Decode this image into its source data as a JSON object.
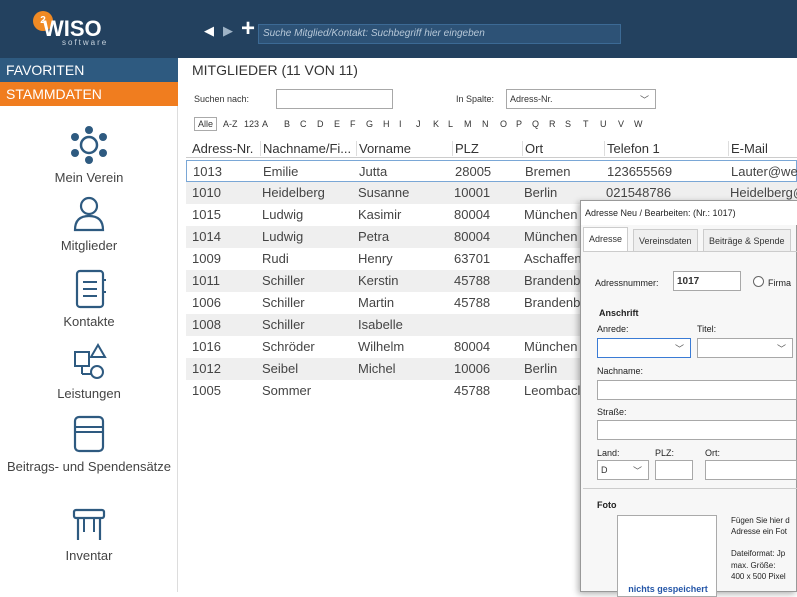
{
  "app": {
    "logo_badge": "2",
    "logo_text": "WISO",
    "logo_sub": "software"
  },
  "toolbar": {
    "back_icon": "chevron-left-icon",
    "forward_icon": "chevron-right-icon",
    "add_icon": "plus-icon",
    "search_placeholder": "Suche Mitglied/Kontakt: Suchbegriff hier eingeben"
  },
  "sidebar": {
    "favoriten": "FAVORITEN",
    "stammdaten": "STAMMDATEN",
    "items": [
      {
        "label": "Mein Verein",
        "icon": "network-icon"
      },
      {
        "label": "Mitglieder",
        "icon": "person-icon"
      },
      {
        "label": "Kontakte",
        "icon": "contact-book-icon"
      },
      {
        "label": "Leistungen",
        "icon": "shapes-icon"
      },
      {
        "label": "Beitrags- und Spendensätze",
        "icon": "wallet-icon"
      },
      {
        "label": "Inventar",
        "icon": "table-icon"
      }
    ]
  },
  "main": {
    "title": "MITGLIEDER (11 VON 11)",
    "search_label": "Suchen nach:",
    "search_value": "",
    "column_label": "In Spalte:",
    "column_value": "Adress-Nr.",
    "alpha_all": "Alle",
    "alpha": [
      "A-Z",
      "123",
      "A",
      "B",
      "C",
      "D",
      "E",
      "F",
      "G",
      "H",
      "I",
      "J",
      "K",
      "L",
      "M",
      "N",
      "O",
      "P",
      "Q",
      "R",
      "S",
      "T",
      "U",
      "V",
      "W"
    ]
  },
  "table": {
    "columns": [
      "Adress-Nr.",
      "Nachname/Fi...",
      "Vorname",
      "PLZ",
      "Ort",
      "Telefon 1",
      "E-Mail"
    ],
    "rows": [
      [
        "1013",
        "Emilie",
        "Jutta",
        "28005",
        "Bremen",
        "123655569",
        "Lauter@web"
      ],
      [
        "1010",
        "Heidelberg",
        "Susanne",
        "10001",
        "Berlin",
        "021548786",
        "Heidelberg@"
      ],
      [
        "1015",
        "Ludwig",
        "Kasimir",
        "80004",
        "München",
        "",
        ""
      ],
      [
        "1014",
        "Ludwig",
        "Petra",
        "80004",
        "München",
        "",
        ""
      ],
      [
        "1009",
        "Rudi",
        "Henry",
        "63701",
        "Aschaffen",
        "",
        ""
      ],
      [
        "1011",
        "Schiller",
        "Kerstin",
        "45788",
        "Brandenb",
        "",
        ""
      ],
      [
        "1006",
        "Schiller",
        "Martin",
        "45788",
        "Brandenb",
        "",
        ""
      ],
      [
        "1008",
        "Schiller",
        "Isabelle",
        "",
        "",
        "",
        ""
      ],
      [
        "1016",
        "Schröder",
        "Wilhelm",
        "80004",
        "München",
        "",
        ""
      ],
      [
        "1012",
        "Seibel",
        "Michel",
        "10006",
        "Berlin",
        "",
        ""
      ],
      [
        "1005",
        "Sommer",
        "",
        "45788",
        "Leombacl",
        "",
        ""
      ]
    ]
  },
  "dialog": {
    "title": "Adresse Neu / Bearbeiten: (Nr.: 1017)",
    "tabs": [
      "Adresse",
      "Vereinsdaten",
      "Beiträge & Spende"
    ],
    "adressnummer_label": "Adressnummer:",
    "adressnummer_value": "1017",
    "firma_label": "Firma",
    "anschrift": "Anschrift",
    "anrede_label": "Anrede:",
    "titel_label": "Titel:",
    "nachname_label": "Nachname:",
    "strasse_label": "Straße:",
    "land_label": "Land:",
    "land_value": "D",
    "plz_label": "PLZ:",
    "ort_label": "Ort:",
    "foto_label": "Foto",
    "foto_placeholder": "nichts gespeichert",
    "foto_hint": "Fügen Sie hier d Adresse ein Fot",
    "foto_format": "Dateiformat: Jp",
    "foto_size": "max. Größe:",
    "foto_dims": "400 x 500 Pixel"
  }
}
